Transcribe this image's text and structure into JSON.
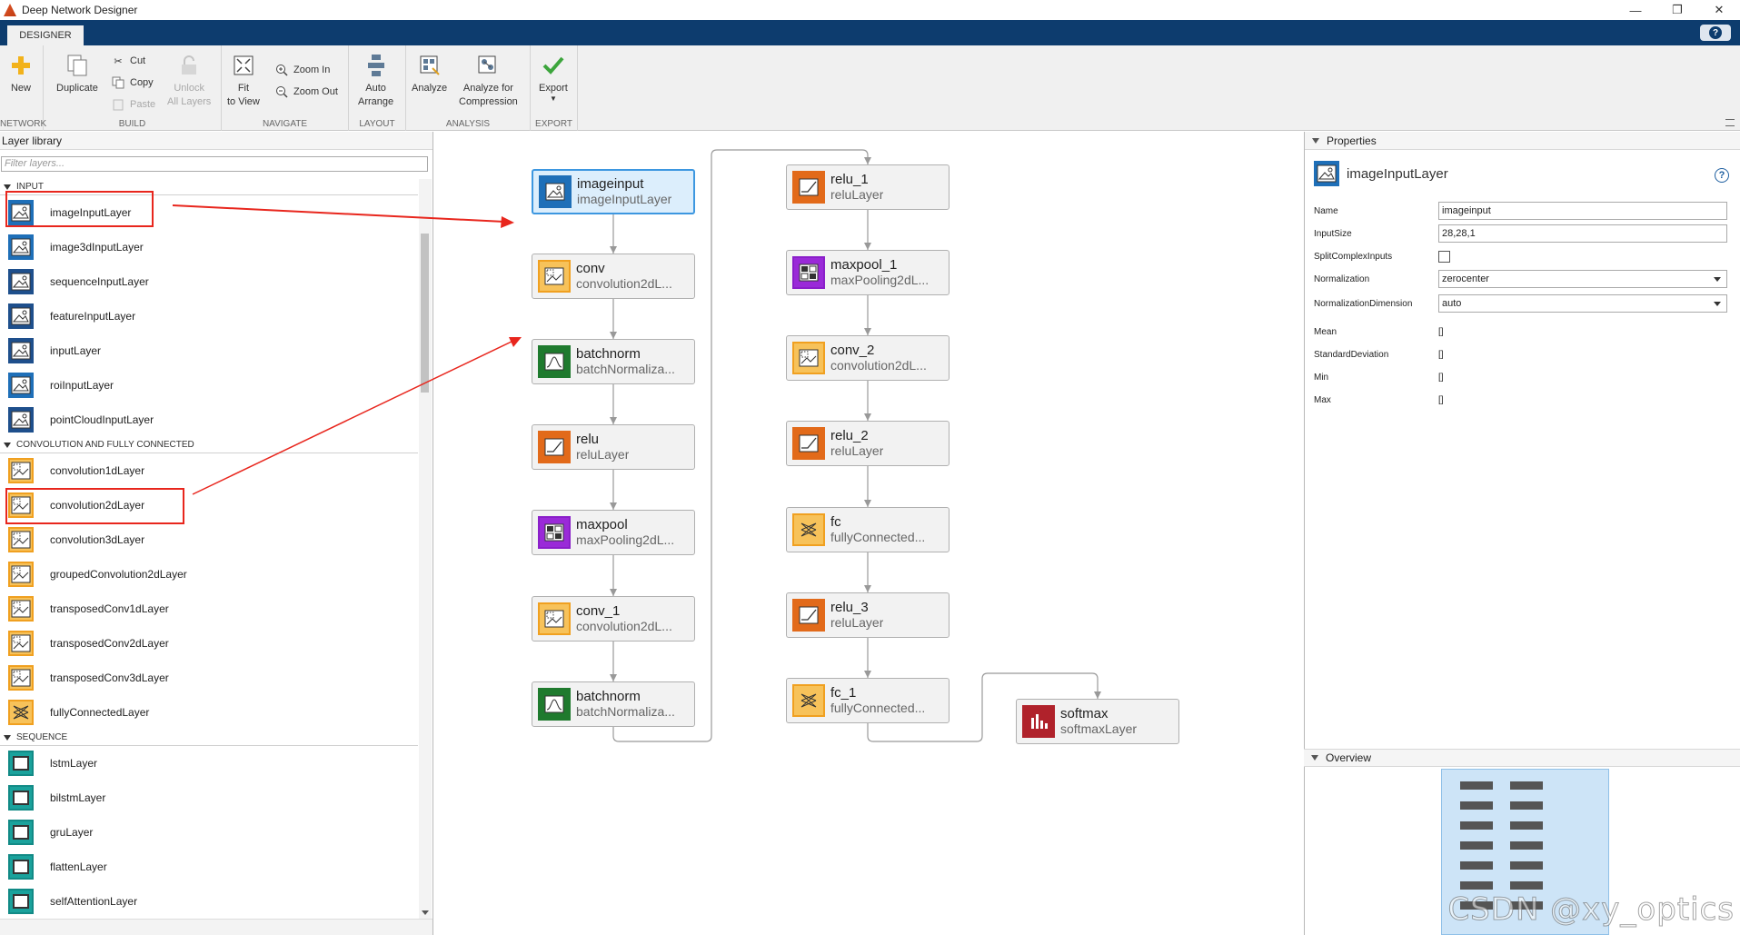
{
  "window": {
    "title": "Deep Network Designer",
    "min": "—",
    "max": "❐",
    "close": "✕"
  },
  "tab": {
    "label": "DESIGNER",
    "help": "?"
  },
  "toolstrip": {
    "groups": {
      "network": "NETWORK",
      "build": "BUILD",
      "navigate": "NAVIGATE",
      "layout": "LAYOUT",
      "analysis": "ANALYSIS",
      "export": "EXPORT"
    },
    "new": "New",
    "duplicate": "Duplicate",
    "cut": "Cut",
    "copy": "Copy",
    "paste": "Paste",
    "unlock_1": "Unlock",
    "unlock_2": "All Layers",
    "fit_1": "Fit",
    "fit_2": "to View",
    "zoom_in": "Zoom In",
    "zoom_out": "Zoom Out",
    "auto_1": "Auto",
    "auto_2": "Arrange",
    "analyze": "Analyze",
    "analyze_comp_1": "Analyze for",
    "analyze_comp_2": "Compression",
    "export": "Export"
  },
  "library": {
    "title": "Layer library",
    "filter_placeholder": "Filter layers...",
    "sections": [
      {
        "name": "INPUT",
        "items": [
          "imageInputLayer",
          "image3dInputLayer",
          "sequenceInputLayer",
          "featureInputLayer",
          "inputLayer",
          "roiInputLayer",
          "pointCloudInputLayer"
        ]
      },
      {
        "name": "CONVOLUTION AND FULLY CONNECTED",
        "items": [
          "convolution1dLayer",
          "convolution2dLayer",
          "convolution3dLayer",
          "groupedConvolution2dLayer",
          "transposedConv1dLayer",
          "transposedConv2dLayer",
          "transposedConv3dLayer",
          "fullyConnectedLayer"
        ]
      },
      {
        "name": "SEQUENCE",
        "items": [
          "lstmLayer",
          "bilstmLayer",
          "gruLayer",
          "flattenLayer",
          "selfAttentionLayer"
        ]
      }
    ]
  },
  "network": {
    "nodes": [
      {
        "name": "imageinput",
        "type": "imageInputLayer",
        "kind": "input"
      },
      {
        "name": "conv",
        "type": "convolution2dL...",
        "kind": "conv"
      },
      {
        "name": "batchnorm",
        "type": "batchNormaliza...",
        "kind": "bn"
      },
      {
        "name": "relu",
        "type": "reluLayer",
        "kind": "relu"
      },
      {
        "name": "maxpool",
        "type": "maxPooling2dL...",
        "kind": "pool"
      },
      {
        "name": "conv_1",
        "type": "convolution2dL...",
        "kind": "conv"
      },
      {
        "name": "batchnorm",
        "type": "batchNormaliza...",
        "kind": "bn"
      },
      {
        "name": "relu_1",
        "type": "reluLayer",
        "kind": "relu"
      },
      {
        "name": "maxpool_1",
        "type": "maxPooling2dL...",
        "kind": "pool"
      },
      {
        "name": "conv_2",
        "type": "convolution2dL...",
        "kind": "conv"
      },
      {
        "name": "relu_2",
        "type": "reluLayer",
        "kind": "relu"
      },
      {
        "name": "fc",
        "type": "fullyConnected...",
        "kind": "fc"
      },
      {
        "name": "relu_3",
        "type": "reluLayer",
        "kind": "relu"
      },
      {
        "name": "fc_1",
        "type": "fullyConnected...",
        "kind": "fc"
      },
      {
        "name": "softmax",
        "type": "softmaxLayer",
        "kind": "softmax"
      }
    ]
  },
  "properties": {
    "title": "Properties",
    "layer_type": "imageInputLayer",
    "rows": {
      "name": {
        "label": "Name",
        "value": "imageinput"
      },
      "input_size": {
        "label": "InputSize",
        "value": "28,28,1"
      },
      "split_complex": {
        "label": "SplitComplexInputs"
      },
      "normalization": {
        "label": "Normalization",
        "value": "zerocenter"
      },
      "norm_dim": {
        "label": "NormalizationDimension",
        "value": "auto"
      },
      "mean": {
        "label": "Mean",
        "value": "[]"
      },
      "std": {
        "label": "StandardDeviation",
        "value": "[]"
      },
      "min": {
        "label": "Min",
        "value": "[]"
      },
      "max": {
        "label": "Max",
        "value": "[]"
      }
    }
  },
  "overview": {
    "title": "Overview"
  },
  "watermark": "CSDN @xy_optics",
  "colors": {
    "accent": "#0d3c6e",
    "highlight": "#e8261d",
    "selected_border": "#3d97e0"
  }
}
